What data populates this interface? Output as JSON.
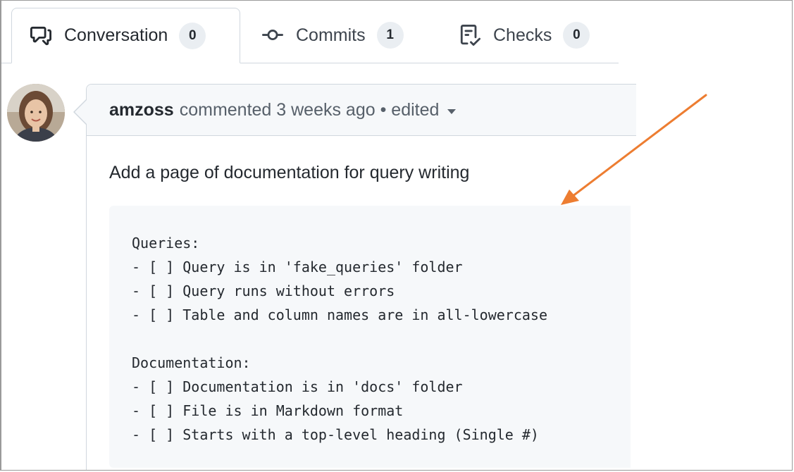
{
  "tabs": [
    {
      "label": "Conversation",
      "count": "0",
      "icon": "comment-discussion-icon",
      "active": true
    },
    {
      "label": "Commits",
      "count": "1",
      "icon": "git-commit-icon",
      "active": false
    },
    {
      "label": "Checks",
      "count": "0",
      "icon": "checklist-icon",
      "active": false
    }
  ],
  "comment": {
    "author": "amzoss",
    "meta": "commented 3 weeks ago • edited",
    "description": "Add a page of documentation for query writing",
    "code": "Queries:\n- [ ] Query is in 'fake_queries' folder\n- [ ] Query runs without errors\n- [ ] Table and column names are in all-lowercase\n\nDocumentation:\n- [ ] Documentation is in 'docs' folder\n- [ ] File is in Markdown format\n- [ ] Starts with a top-level heading (Single #)"
  },
  "colors": {
    "annotation_arrow": "#ed7d31",
    "counter_bg": "#eaeef2",
    "code_bg": "#f6f8fa"
  }
}
